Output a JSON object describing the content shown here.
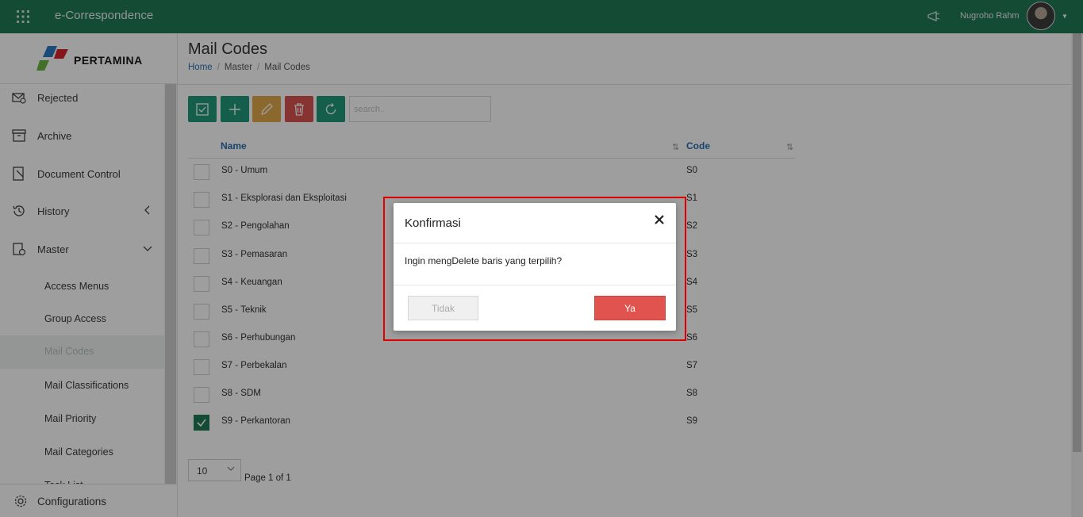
{
  "app": {
    "title": "e-Correspondence",
    "user_name": "Nugroho Rahm"
  },
  "brand": {
    "name": "PERTAMINA"
  },
  "sidebar": {
    "items": [
      {
        "label": "Rejected",
        "icon": "mail-reject-icon"
      },
      {
        "label": "Archive",
        "icon": "archive-icon"
      },
      {
        "label": "Document Control",
        "icon": "document-control-icon"
      },
      {
        "label": "History",
        "icon": "history-icon"
      },
      {
        "label": "Master",
        "icon": "master-icon"
      }
    ],
    "sub_items": [
      {
        "label": "Access Menus"
      },
      {
        "label": "Group Access"
      },
      {
        "label": "Mail Codes",
        "active": true
      },
      {
        "label": "Mail Classifications"
      },
      {
        "label": "Mail Priority"
      },
      {
        "label": "Mail Categories"
      },
      {
        "label": "Task List"
      }
    ],
    "footer": {
      "label": "Configurations",
      "icon": "gear-icon"
    }
  },
  "page": {
    "title": "Mail Codes",
    "breadcrumb": [
      "Home",
      "Master",
      "Mail Codes"
    ]
  },
  "toolbar": {
    "search_placeholder": "search..",
    "colors": {
      "check": "#1f9a7a",
      "add": "#1f9a7a",
      "edit": "#e0a84a",
      "delete": "#d9534f",
      "refresh": "#1f9a7a"
    }
  },
  "table": {
    "columns": [
      "Name",
      "Code"
    ],
    "rows": [
      {
        "name": "S0 - Umum",
        "code": "S0",
        "checked": false
      },
      {
        "name": "S1 - Eksplorasi dan Eksploitasi",
        "code": "S1",
        "checked": false
      },
      {
        "name": "S2 - Pengolahan",
        "code": "S2",
        "checked": false
      },
      {
        "name": "S3 - Pemasaran",
        "code": "S3",
        "checked": false
      },
      {
        "name": "S4 - Keuangan",
        "code": "S4",
        "checked": false
      },
      {
        "name": "S5 - Teknik",
        "code": "S5",
        "checked": false
      },
      {
        "name": "S6 - Perhubungan",
        "code": "S6",
        "checked": false
      },
      {
        "name": "S7 - Perbekalan",
        "code": "S7",
        "checked": false
      },
      {
        "name": "S8 - SDM",
        "code": "S8",
        "checked": false
      },
      {
        "name": "S9 - Perkantoran",
        "code": "S9",
        "checked": true
      }
    ]
  },
  "pagination": {
    "page_size": "10",
    "info": "Page 1 of 1"
  },
  "modal": {
    "title": "Konfirmasi",
    "message": "Ingin mengDelete baris yang terpilih?",
    "cancel_label": "Tidak",
    "confirm_label": "Ya"
  }
}
